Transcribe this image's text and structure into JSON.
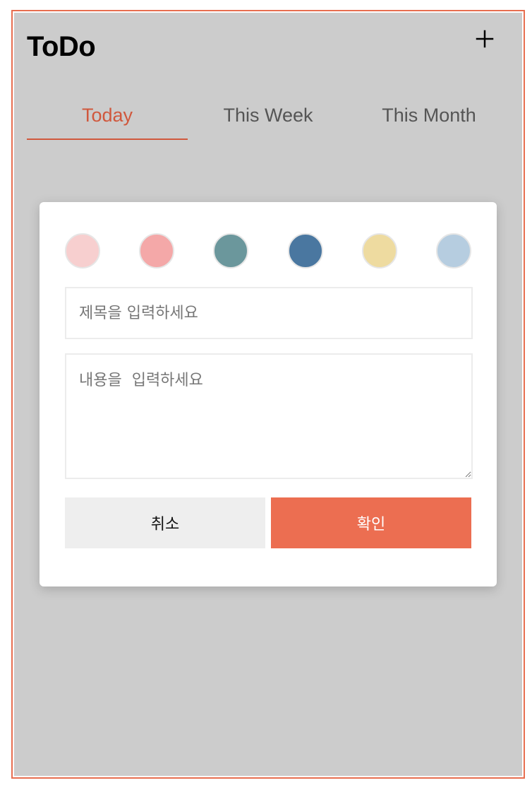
{
  "app": {
    "title": "ToDo",
    "add_icon": "plus-icon"
  },
  "tabs": [
    {
      "label": "Today",
      "active": true
    },
    {
      "label": "This Week",
      "active": false
    },
    {
      "label": "This Month",
      "active": false
    }
  ],
  "modal": {
    "swatches": [
      {
        "name": "light-pink",
        "color": "#f7cfcf"
      },
      {
        "name": "pink",
        "color": "#f4a8a8"
      },
      {
        "name": "teal",
        "color": "#6b979c"
      },
      {
        "name": "steel-blue",
        "color": "#4a77a0"
      },
      {
        "name": "sand",
        "color": "#eedba0"
      },
      {
        "name": "light-blue",
        "color": "#b6cde0"
      }
    ],
    "title_placeholder": "제목을 입력하세요",
    "title_value": "",
    "content_placeholder": "내용을  입력하세요",
    "content_value": "",
    "cancel_label": "취소",
    "confirm_label": "확인"
  },
  "colors": {
    "accent": "#ec6e51",
    "active_tab": "#d0583d",
    "background": "#cccccc"
  }
}
